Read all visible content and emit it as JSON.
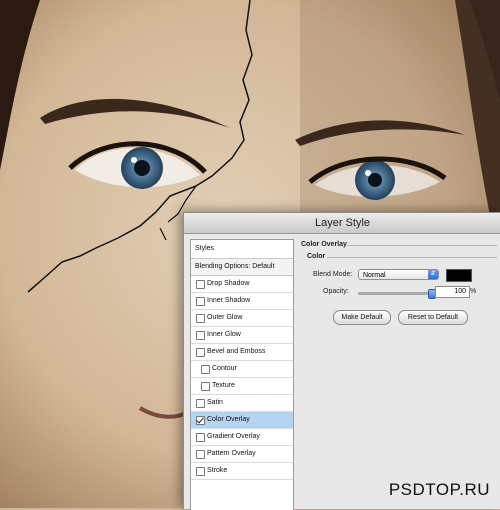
{
  "dialog": {
    "title": "Layer Style",
    "styles_header": "Styles",
    "blending_options": "Blending Options: Default",
    "effects": [
      {
        "label": "Drop Shadow",
        "checked": false,
        "sub": false,
        "selected": false
      },
      {
        "label": "Inner Shadow",
        "checked": false,
        "sub": false,
        "selected": false
      },
      {
        "label": "Outer Glow",
        "checked": false,
        "sub": false,
        "selected": false
      },
      {
        "label": "Inner Glow",
        "checked": false,
        "sub": false,
        "selected": false
      },
      {
        "label": "Bevel and Emboss",
        "checked": false,
        "sub": false,
        "selected": false
      },
      {
        "label": "Contour",
        "checked": false,
        "sub": true,
        "selected": false
      },
      {
        "label": "Texture",
        "checked": false,
        "sub": true,
        "selected": false
      },
      {
        "label": "Satin",
        "checked": false,
        "sub": false,
        "selected": false
      },
      {
        "label": "Color Overlay",
        "checked": true,
        "sub": false,
        "selected": true
      },
      {
        "label": "Gradient Overlay",
        "checked": false,
        "sub": false,
        "selected": false
      },
      {
        "label": "Pattern Overlay",
        "checked": false,
        "sub": false,
        "selected": false
      },
      {
        "label": "Stroke",
        "checked": false,
        "sub": false,
        "selected": false
      }
    ],
    "overlay": {
      "section_title": "Color Overlay",
      "group_title": "Color",
      "blend_mode_label": "Blend Mode:",
      "blend_mode_value": "Normal",
      "overlay_color": "#000000",
      "opacity_label": "Opacity:",
      "opacity_value": "100",
      "opacity_fraction": 1.0,
      "opacity_unit": "%",
      "make_default_label": "Make Default",
      "reset_default_label": "Reset to Default"
    }
  },
  "watermark": "PSDTOP.RU"
}
